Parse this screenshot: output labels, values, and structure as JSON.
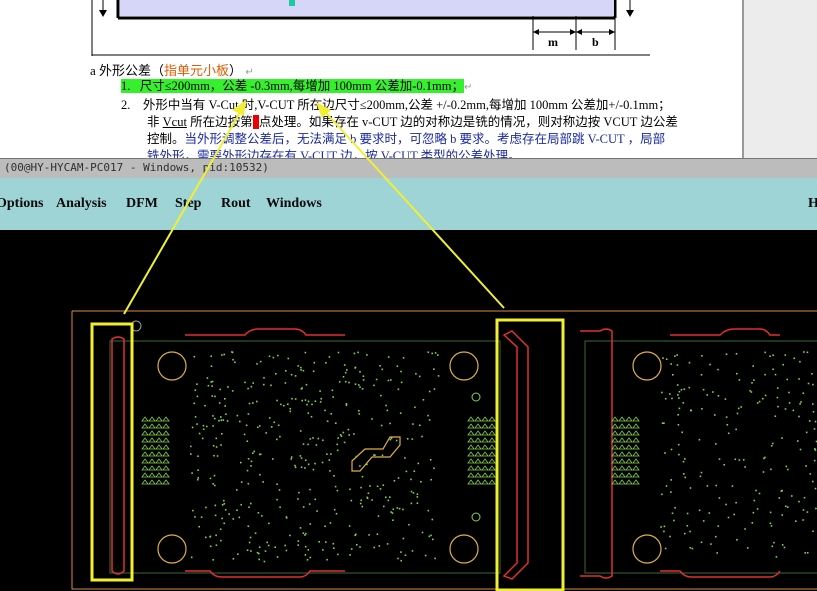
{
  "document": {
    "dim_m": "m",
    "dim_b": "b",
    "heading_prefix": "a 外形公差（",
    "heading_emph": "指单元小板",
    "heading_suffix": "）",
    "item1_num": "1.",
    "item1_text": "尺寸≤200mm，公差 -0.3mm,每增加 100mm 公差加-0.1mm；",
    "item2_num": "2.",
    "item2_line1": "外形中当有 V-Cut 时,V-CUT 所在边尺寸≤200mm,公差 +/-0.2mm,每增加 100mm 公差加+/-0.1mm；",
    "item2_line2a": "非 ",
    "item2_line2b": "Vcut",
    "item2_line2c": " 所在边按第",
    "item2_line2d": "1",
    "item2_line2e": "点处理。如果存在 v-CUT 边的对称边是铣的情况，则对称边按 VCUT 边公差",
    "item2_line3a": "控制。",
    "item2_line3b": "当外形调整公差后，无法满足 b 要求时，可忽略 b 要求。考虑存在局部跳 V-CUT ，局部",
    "item2_line4": "铣外形，需要外形边存在有 V-CUT 边，按 V-CUT 类型的公差处理。"
  },
  "window": {
    "title": "(00@HY-HYCAM-PC017 - Windows, pid:10532)"
  },
  "menu": {
    "options": "Options",
    "analysis": "Analysis",
    "dfm": "DFM",
    "step": "Step",
    "rout": "Rout",
    "windows": "Windows",
    "help": "H"
  },
  "colors": {
    "highlight": "#36f02e",
    "menubar": "#9fd4d6",
    "annotation": "#f0f030",
    "outline": "#e03030",
    "pads": "#7fd44a",
    "board_edge": "#e08a3a"
  }
}
